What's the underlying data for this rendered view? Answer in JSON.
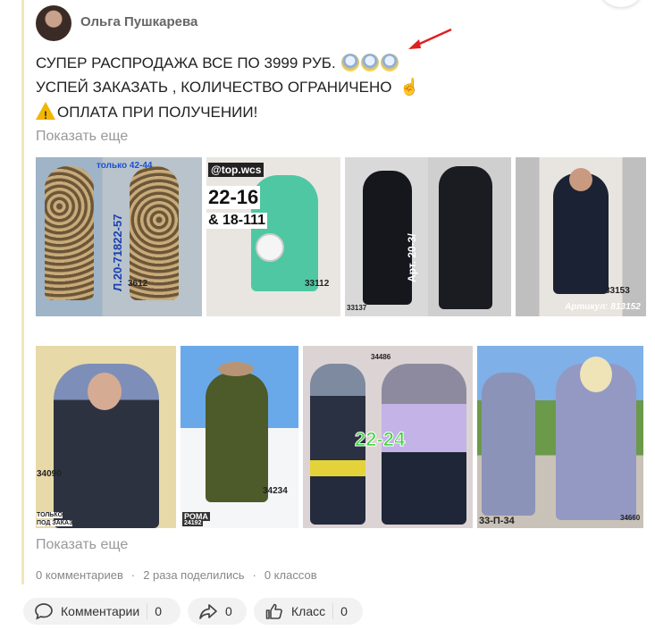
{
  "post": {
    "author": "Ольга Пушкарева",
    "line1": "СУПЕР РАСПРОДАЖА ВСЕ ПО 3999 РУБ.",
    "line2": "УСПЕЙ ЗАКАЗАТЬ , КОЛИЧЕСТВО ОГРАНИЧЕНО",
    "line3": "ОПЛАТА ПРИ ПОЛУЧЕНИИ!",
    "show_more_top": "Показать еще",
    "show_more_bottom": "Показать еще"
  },
  "photos": {
    "p1": {
      "tag": "только 42-44",
      "vertical": "Л.20-71822-57",
      "code": "3612"
    },
    "p2": {
      "handle": "@top.wcs",
      "size1": "22-16",
      "size2": "& 18-111",
      "code": "33112"
    },
    "p3": {
      "vertical": "Арт. 20-3/",
      "code": "33137"
    },
    "p4": {
      "code": "33153",
      "label": "Артикул: 813152"
    },
    "p5": {
      "code": "34090",
      "note1": "ТОЛЬКО",
      "note2": "ПОД ЗАКАЗ"
    },
    "p6": {
      "code": "34234",
      "label1": "РОМА",
      "label2": "24192"
    },
    "p7": {
      "code": "34486",
      "size": "22-24"
    },
    "p8": {
      "code": "34660",
      "label": "33-П-34"
    }
  },
  "stats": {
    "comments": "0 комментариев",
    "shares": "2 раза поделились",
    "likes": "0 классов"
  },
  "actions": {
    "comments_label": "Комментарии",
    "comments_count": "0",
    "share_count": "0",
    "class_label": "Класс",
    "class_count": "0"
  },
  "icons": {
    "comment": "comment-bubble-icon",
    "share": "share-arrow-icon",
    "like": "thumbs-up-icon",
    "warning": "warning-icon",
    "annotation": "red-arrow-icon"
  },
  "colors": {
    "accent_bar": "#f2e6b8",
    "annotation_red": "#e02020",
    "pill_bg": "#f2f2f2"
  }
}
